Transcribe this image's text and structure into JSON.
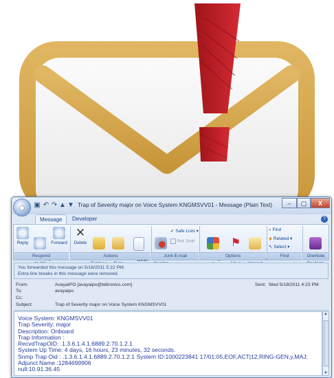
{
  "window": {
    "title": "Trap of Severity major on Voice System KNGMSVV01 - Message (Plain Text)",
    "controls": [
      "–",
      "▢",
      "X"
    ]
  },
  "tabs": [
    {
      "label": "Message",
      "active": true
    },
    {
      "label": "Developer",
      "active": false
    }
  ],
  "ribbon": {
    "respond": {
      "reply": "Reply",
      "reply_all": "Reply\nto All",
      "forward": "Forward",
      "group": "Respond"
    },
    "actions": {
      "delete": "Delete",
      "move": "Move to\nFolder ▾",
      "create_rule": "Create\nRule",
      "other": "Other\nActions ▾",
      "group": "Actions"
    },
    "junk": {
      "block": "Block\nSender",
      "safe_lists": "Safe Lists ▾",
      "not_junk": "Not Junk",
      "group": "Junk E-mail"
    },
    "options": {
      "categorize": "Categorize\n▾",
      "follow_up": "Follow\nUp ▾",
      "mark_as_unread": "Mark as\nUnread",
      "group": "Options"
    },
    "find": {
      "find": "Find",
      "related": "Related ▾",
      "select": "Select ▾",
      "group": "Find"
    },
    "onenote": {
      "send": "Send to\nOneNote",
      "group": "OneNote"
    }
  },
  "notice": {
    "line1": "You forwarded this message on 5/18/2011 5:22 PM.",
    "line2": "Extra line breaks in this message were removed."
  },
  "headers": {
    "from_label": "From:",
    "from_value": "AvayaIPO [avayaipo@teltronics.com]",
    "sent_label": "Sent:",
    "sent_value": "Wed 5/18/2011 4:23 PM",
    "to_label": "To:",
    "to_value": "avayaipo",
    "cc_label": "Cc:",
    "cc_value": "",
    "subject_label": "Subject:",
    "subject_value": "Trap of Severity major on Voice System KNGMSVV01"
  },
  "body_lines": [
    "Voice System: KNGMSVV01",
    "Trap Severity: major",
    "Description: Onboard",
    "Trap Information :",
    " RecvdTrapOID: .1.3.6.1.4.1.6889.2.70.1.2.1",
    "System Up Time: 4 days, 16 hours, 23 minutes, 32 seconds.",
    "Snmp Trap Oid : .1.3.6.1.4.1.6889.2.70.1.2.1 System ID:1000223841 17/01:05,EOF,ACT|12,RING-GEN,y,MAJ;",
    "Adjunct Name :1284699906",
    "null:10.91.36.45"
  ],
  "colors": {
    "envelope_frame": "#d4a64d",
    "envelope_inner": "#f3f3f3",
    "exclamation_red": "#c8202a",
    "window_frame": "#dfe8f5",
    "body_text": "#1f3c9c"
  }
}
